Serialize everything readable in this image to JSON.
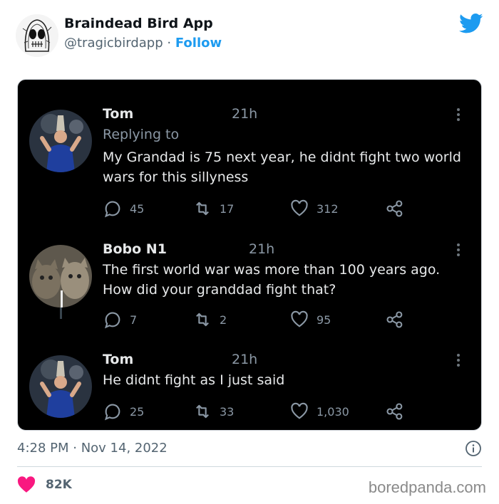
{
  "account": {
    "display_name": "Braindead Bird App",
    "handle": "@tragicbirdapp",
    "separator": "·",
    "follow_label": "Follow"
  },
  "screenshot": {
    "replies": [
      {
        "name": "Tom",
        "time": "21h",
        "replying_to": "Replying to",
        "text": "My Grandad is 75 next year,  he didnt fight two world wars for this sillyness",
        "comments": "45",
        "retweets": "17",
        "likes": "312"
      },
      {
        "name": "Bobo N1",
        "time": "21h",
        "text": "The first world war was more than 100 years ago. How did your granddad fight that?",
        "comments": "7",
        "retweets": "2",
        "likes": "95"
      },
      {
        "name": "Tom",
        "time": "21h",
        "text": "He didnt fight as I just said",
        "comments": "25",
        "retweets": "33",
        "likes": "1,030"
      }
    ]
  },
  "footer": {
    "timestamp": "4:28 PM · Nov 14, 2022",
    "like_count": "82K",
    "watermark": "boredpanda.com"
  },
  "colors": {
    "twitter_blue": "#1d9bf0",
    "like_pink": "#f91880",
    "screenshot_bg": "#000000"
  },
  "icons": [
    "bird-logo-icon",
    "comment-icon",
    "retweet-icon",
    "heart-icon",
    "share-icon",
    "more-icon",
    "info-icon"
  ]
}
